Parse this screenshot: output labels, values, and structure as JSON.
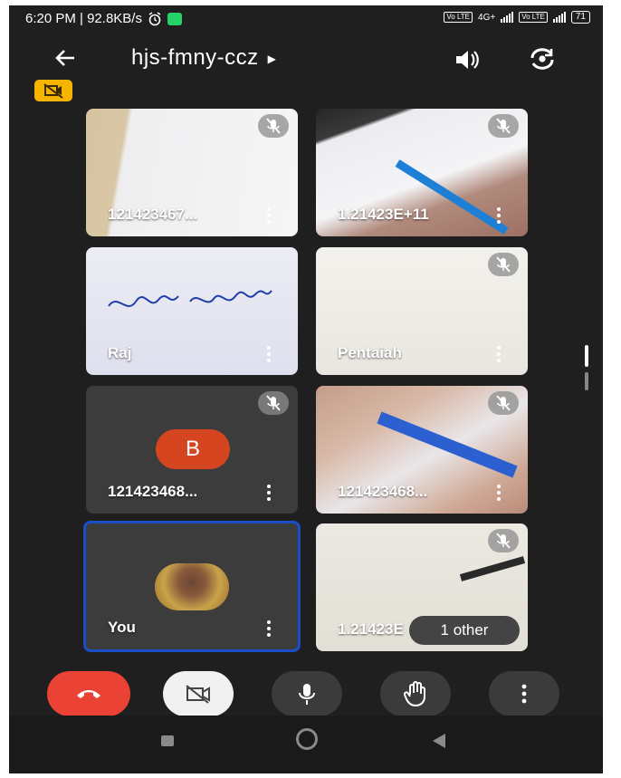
{
  "status": {
    "time_speed": "6:20 PM | 92.8KB/s",
    "volte1": "Vo LTE",
    "net": "4G+",
    "volte2": "Vo LTE",
    "battery": "71"
  },
  "header": {
    "title": "hjs-fmny-ccz",
    "back_icon": "arrow-left-icon",
    "speaker_icon": "speaker-icon",
    "flip_icon": "camera-flip-icon"
  },
  "tiles": [
    {
      "name": "121423467..."
    },
    {
      "name": "1.21423E+11"
    },
    {
      "name": "Raj"
    },
    {
      "name": "Pentaiah"
    },
    {
      "name": "121423468...",
      "avatar_letter": "B"
    },
    {
      "name": "121423468..."
    },
    {
      "name": "You"
    },
    {
      "name": "1.21423E"
    }
  ],
  "others_pill": "1 other",
  "controls": [
    "end-call-icon",
    "camera-off-icon",
    "microphone-icon",
    "raise-hand-icon",
    "more-options-icon"
  ],
  "colors": {
    "end_call": "#ea4335",
    "camera_badge": "#f5b400",
    "avatar_b": "#d5451f",
    "selected_border": "#1a4fc7"
  }
}
